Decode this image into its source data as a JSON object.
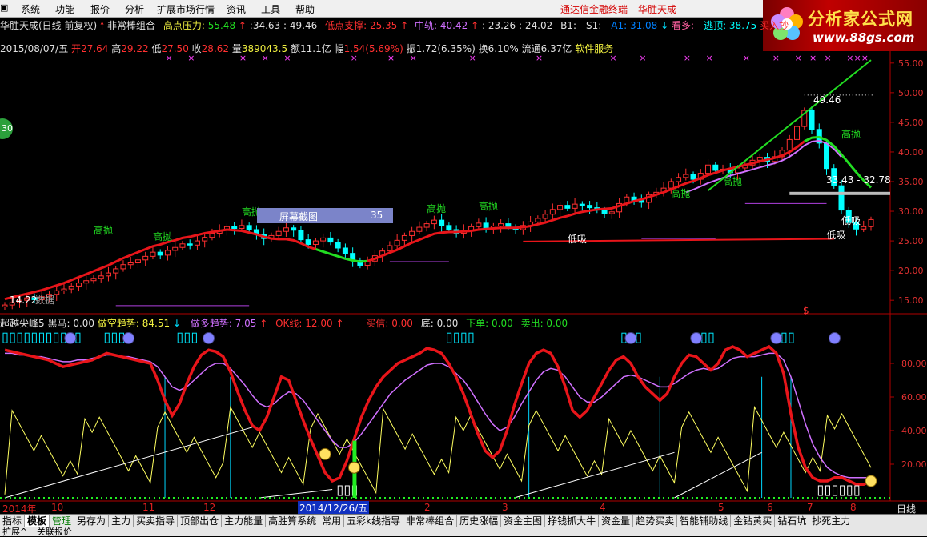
{
  "menu": {
    "items": [
      "系统",
      "功能",
      "报价",
      "分析",
      "扩展市场行情",
      "资讯",
      "工具",
      "帮助"
    ],
    "promo1": "通达信金融终端",
    "promo2": "华胜天成"
  },
  "logo": {
    "text": "分析家公式网",
    "url": "www.88gs.com"
  },
  "header": {
    "stock": "华胜天成(日线 前复权)",
    "formula": "非常棒组合",
    "resist_label": "高点压力:",
    "resist_value": "55.48",
    "v1": ":34.63",
    "v2": ": 49.46",
    "support_label": "低点支撑:",
    "support_value": "25.35",
    "mid_label": "中轨:",
    "mid_value": "40.42",
    "v3": ": 23.26",
    "v4": ": 24.02",
    "b1": "B1: -",
    "s1": "S1: -",
    "a1": "A1: 31.08",
    "kanduo": "看多: -",
    "taoding": "逃顶: 38.75",
    "buyin": "买入抄"
  },
  "info": {
    "date": "2015/08/07/五",
    "open_label": "开",
    "open": "27.64",
    "high_label": "高",
    "high": "29.22",
    "low_label": "低",
    "low": "27.50",
    "close_label": "收",
    "close": "28.62",
    "vol_label": "量",
    "vol": "389043.5",
    "amt_label": "额",
    "amt": "11.1亿",
    "pct_label": "幅",
    "pct": "1.54(5.69%)",
    "amp_label": "振",
    "amp": "1.72(6.35%)",
    "turn_label": "换",
    "turn": "6.10%",
    "float_label": "流通",
    "float": "6.37亿",
    "service": "软件服务"
  },
  "price_axis": [
    "55.00",
    "50.00",
    "45.00",
    "40.00",
    "35.00",
    "30.00",
    "25.00",
    "20.00",
    "15.00"
  ],
  "annotations": {
    "peak_price": "49.46",
    "range_label": "33.43 - 32.78",
    "low_price": "14.22",
    "gaopao": "高抛",
    "dixi": "低吸",
    "zhangfu": "涨幅",
    "shuju": "数据",
    "dollar": "$"
  },
  "screenshot_box": {
    "label": "屏幕截图",
    "value": "35"
  },
  "circle_badge": "30",
  "indicator": {
    "name": "超越尖峰5",
    "heima": "黑马: 0.00",
    "zuokong": "做空趋势: 84.51",
    "zuoduo": "做多趋势: 7.05",
    "okline": "OK线: 12.00",
    "buy": "买信: 0.00",
    "bottom": "底: 0.00",
    "xiadan": "下单: 0.00",
    "sell": "卖出: 0.00"
  },
  "ind_axis": [
    "80.00",
    "60.00",
    "40.00",
    "20.00"
  ],
  "dates": [
    "2014年",
    "10",
    "11",
    "12",
    "2014/12/26/五",
    "2",
    "3",
    "4",
    "5",
    "6",
    "7",
    "8"
  ],
  "period": "日线",
  "tabs": [
    "指标",
    "模板",
    "管理",
    "另存为",
    "主力",
    "买卖指导",
    "顶部出仓",
    "主力能量",
    "高胜算系统",
    "常用",
    "五彩k线指导",
    "非常棒组合",
    "历史涨幅",
    "资金主图",
    "挣钱抓大牛",
    "资金量",
    "趋势买卖",
    "智能辅助线",
    "金钻黄买",
    "钻石坑",
    "抄死主力"
  ],
  "bottom_left": "扩展^",
  "bottom_left2": "关联报价",
  "colors": {
    "up": "#ff3030",
    "down": "#00ffff",
    "ma_red": "#e8151a",
    "ma_green": "#22dd22",
    "violet": "#d070ff",
    "yellow": "#ffff60"
  },
  "chart_data": {
    "type": "candlestick",
    "note_x": "trading days approx 2014-09 to 2015-08",
    "price_range": [
      13,
      57
    ],
    "closes": [
      14.2,
      14.6,
      15.0,
      15.4,
      15.1,
      15.6,
      16.0,
      16.6,
      16.9,
      17.4,
      17.9,
      18.3,
      18.7,
      19.1,
      19.6,
      20.3,
      21.0,
      21.3,
      21.8,
      22.4,
      23.1,
      22.6,
      23.4,
      23.9,
      24.5,
      24.3,
      25.0,
      25.6,
      26.3,
      26.8,
      27.4,
      27.1,
      27.6,
      26.9,
      26.1,
      25.4,
      25.9,
      26.6,
      27.2,
      26.8,
      25.2,
      24.4,
      25.0,
      25.5,
      24.8,
      23.8,
      22.9,
      21.7,
      20.9,
      21.6,
      22.5,
      23.3,
      24.2,
      25.1,
      25.9,
      26.6,
      27.3,
      27.9,
      28.5,
      27.6,
      26.9,
      26.3,
      26.8,
      27.4,
      28.0,
      27.1,
      27.5,
      27.9,
      27.3,
      26.9,
      27.6,
      28.2,
      28.8,
      29.5,
      30.3,
      31.0,
      30.5,
      31.2,
      31.0,
      30.6,
      30.2,
      29.6,
      29.9,
      31.3,
      32.4,
      31.8,
      31.5,
      32.8,
      33.2,
      33.9,
      35.0,
      35.7,
      36.2,
      35.4,
      36.4,
      37.8,
      36.9,
      37.1,
      36.5,
      37.3,
      37.8,
      38.6,
      39.1,
      38.4,
      39.2,
      40.3,
      42.1,
      44.3,
      47.0,
      43.8,
      41.5,
      37.2,
      34.3,
      30.2,
      28.1,
      27.0,
      27.4,
      28.6
    ],
    "ma_values": [
      15.2,
      15.5,
      15.8,
      16.1,
      16.4,
      16.7,
      17.1,
      17.5,
      17.9,
      18.4,
      18.9,
      19.4,
      19.9,
      20.4,
      20.9,
      21.5,
      22.1,
      22.6,
      23.1,
      23.6,
      24.1,
      24.4,
      24.8,
      25.1,
      25.5,
      25.7,
      26.0,
      26.3,
      26.5,
      26.7,
      26.9,
      26.8,
      26.7,
      26.4,
      26.1,
      25.7,
      25.4,
      25.3,
      25.3,
      25.1,
      24.6,
      24.0,
      23.6,
      23.2,
      22.8,
      22.4,
      22.0,
      21.7,
      21.5,
      21.6,
      22.0,
      22.5,
      23.0,
      23.5,
      24.1,
      24.7,
      25.2,
      25.7,
      26.2,
      26.4,
      26.5,
      26.5,
      26.6,
      26.7,
      26.9,
      27.0,
      27.1,
      27.2,
      27.2,
      27.2,
      27.3,
      27.5,
      27.8,
      28.1,
      28.5,
      28.9,
      29.2,
      29.6,
      29.9,
      30.1,
      30.3,
      30.4,
      30.5,
      30.9,
      31.3,
      31.7,
      32.0,
      32.4,
      32.8,
      33.2,
      33.7,
      34.2,
      34.7,
      35.1,
      35.6,
      36.1,
      36.5,
      36.9,
      37.2,
      37.5,
      37.8,
      38.1,
      38.4,
      38.7,
      39.0,
      39.4,
      40.0,
      40.8,
      41.8,
      42.4,
      42.5,
      42.0,
      41.0,
      39.6,
      38.1,
      36.6,
      35.2,
      34.0
    ],
    "upper_line": [
      [
        95,
        33.5
      ],
      [
        117,
        55.5
      ]
    ],
    "ind_red": [
      88,
      87,
      86,
      85,
      84,
      83,
      82,
      80,
      78,
      79,
      80,
      81,
      82,
      84,
      86,
      85,
      84,
      83,
      82,
      81,
      80,
      70,
      58,
      49,
      56,
      68,
      78,
      85,
      88,
      87,
      84,
      75,
      63,
      52,
      43,
      40,
      48,
      60,
      72,
      70,
      58,
      46,
      35,
      25,
      15,
      10,
      12,
      22,
      35,
      48,
      58,
      66,
      72,
      76,
      80,
      82,
      84,
      86,
      89,
      88,
      86,
      80,
      72,
      62,
      50,
      38,
      28,
      24,
      28,
      40,
      55,
      68,
      80,
      86,
      88,
      86,
      78,
      66,
      52,
      48,
      52,
      60,
      68,
      76,
      82,
      84,
      80,
      72,
      66,
      62,
      58,
      62,
      72,
      80,
      85,
      84,
      80,
      76,
      80,
      88,
      90,
      88,
      84,
      86,
      88,
      90,
      86,
      74,
      50,
      30,
      18,
      12,
      10,
      10,
      12,
      12,
      10,
      8,
      8,
      10
    ],
    "ind_white_violet": [
      86,
      86,
      85,
      85,
      84,
      84,
      83,
      82,
      81,
      81,
      82,
      82,
      83,
      84,
      85,
      85,
      84,
      84,
      83,
      82,
      81,
      78,
      72,
      66,
      64,
      66,
      70,
      74,
      78,
      80,
      80,
      77,
      72,
      67,
      61,
      56,
      54,
      56,
      60,
      63,
      62,
      58,
      52,
      46,
      40,
      34,
      30,
      30,
      33,
      38,
      44,
      50,
      56,
      62,
      66,
      70,
      73,
      76,
      79,
      80,
      80,
      78,
      74,
      70,
      64,
      57,
      50,
      44,
      40,
      42,
      48,
      56,
      63,
      70,
      75,
      77,
      76,
      72,
      66,
      60,
      57,
      57,
      60,
      64,
      68,
      72,
      73,
      72,
      70,
      68,
      66,
      66,
      68,
      71,
      74,
      76,
      77,
      76,
      77,
      80,
      83,
      84,
      84,
      84,
      85,
      86,
      86,
      82,
      72,
      58,
      44,
      32,
      24,
      18,
      15,
      13,
      12,
      12,
      12,
      12
    ]
  }
}
